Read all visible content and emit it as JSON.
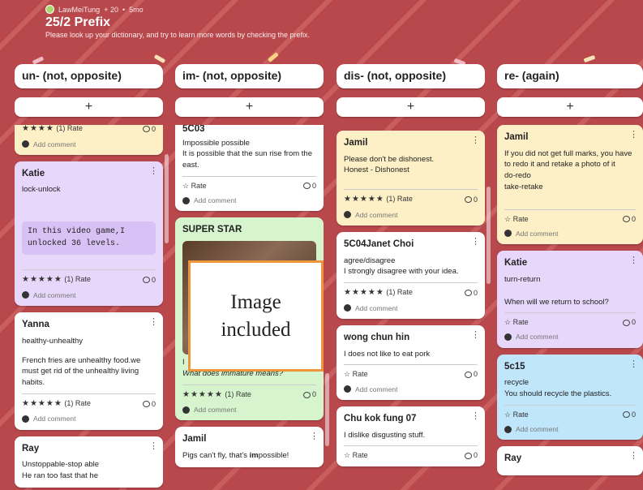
{
  "header": {
    "author": "LawMeiTung",
    "plus_count": "+ 20",
    "age": "5mo",
    "title": "25/2 Prefix",
    "description": "Please look up your dictionary, and try to learn more words by checking the prefix."
  },
  "columns": [
    {
      "title": "un- (not, opposite)",
      "add": "+"
    },
    {
      "title": "im- (not, opposite)",
      "add": "+"
    },
    {
      "title": "dis- (not, opposite)",
      "add": "+"
    },
    {
      "title": "re- (again)",
      "add": "+"
    }
  ],
  "common": {
    "stars5": "★★★★★",
    "stars4": "★★★★",
    "empty_star": "☆",
    "rate": "Rate",
    "rated": "(1) Rate",
    "add_comment": "Add comment",
    "zero": "0",
    "kebab": "⋮"
  },
  "col1": {
    "c0": {
      "rate": "(1) Rate",
      "count": "0"
    },
    "c1": {
      "name": "Katie",
      "line1": "lock-unlock",
      "quote": "In this video game,I unlocked 36 levels.",
      "count": "0"
    },
    "c2": {
      "name": "Yanna",
      "line1": "healthy-unhealthy",
      "body": "French fries are unhealthy food.we must get rid of the unhealthy living habits.",
      "count": "0"
    },
    "c3": {
      "name": "Ray",
      "line1": "Unstoppable-stop able",
      "line2": "He ran too fast that he"
    }
  },
  "col2": {
    "c0": {
      "name": "5C03",
      "line1": "Impossible possible",
      "line2": "It is possible that the sun rise from the east.",
      "count": "0"
    },
    "c1": {
      "name": "SUPER STAR",
      "line1": "I",
      "question": "What does immature means?",
      "count": "0"
    },
    "c2": {
      "name": "Jamil",
      "pre": "Pigs can't fly, that's ",
      "bold": "im",
      "post": "possible!"
    }
  },
  "col3": {
    "c0": {
      "name": "Jamil",
      "line1": "Please don't be dishonest.",
      "line2": "Honest - Dishonest",
      "count": "0"
    },
    "c1": {
      "name": "5C04Janet Choi",
      "line1": "agree/disagree",
      "line2": "I strongly disagree with your idea.",
      "count": "0"
    },
    "c2": {
      "name": "wong chun hin",
      "line1": "I does not like to eat pork",
      "count": "0"
    },
    "c3": {
      "name": "Chu kok fung 07",
      "line1": "I dislike disgusting stuff.",
      "count": "0"
    }
  },
  "col4": {
    "c0": {
      "name": "Jamil",
      "line1": "If you did not get full marks, you have to redo it and retake a photo of it",
      "line2": "do-redo",
      "line3": "take-retake",
      "count": "0"
    },
    "c1": {
      "name": "Katie",
      "line1": "turn-return",
      "line2": "When will we return to school?",
      "count": "0"
    },
    "c2": {
      "name": "5c15",
      "line1": "recycle",
      "line2": "You should recycle the plastics.",
      "count": "0"
    },
    "c3": {
      "name": "Ray"
    }
  },
  "overlay": {
    "line1": "Image",
    "line2": "included"
  },
  "colors": {
    "background": "#b8484c",
    "yellow": "#fdf0c6",
    "purple": "#e7d7fb",
    "green": "#d6f4cd",
    "blue": "#bfe6fb",
    "overlay_border": "#f0963a"
  }
}
